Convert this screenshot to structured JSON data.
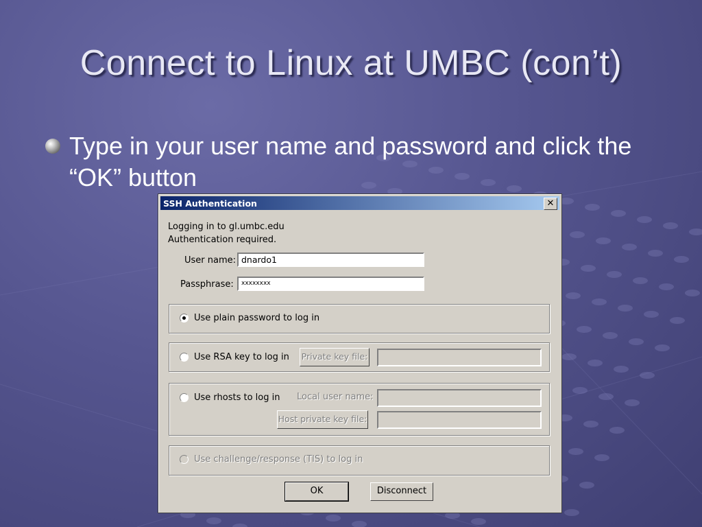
{
  "slide": {
    "title": "Connect to Linux at UMBC (con’t)",
    "bullet": "Type in your user name and password and click the “OK” button"
  },
  "dialog": {
    "title": "SSH Authentication",
    "close_glyph": "✕",
    "info_line1": "Logging in to gl.umbc.edu",
    "info_line2": "Authentication required.",
    "username_label": "User name:",
    "username_value": "dnardo1",
    "passphrase_label": "Passphrase:",
    "passphrase_value": "xxxxxxxx",
    "option_password": "Use plain password to log in",
    "option_rsa": "Use RSA key to log in",
    "private_key_button": "Private key file:",
    "option_rhosts": "Use rhosts to log in",
    "local_user_label": "Local user name:",
    "host_key_button": "Host private key file:",
    "option_tis": "Use challenge/response (TIS) to log in",
    "ok_label": "OK",
    "disconnect_label": "Disconnect",
    "selected_option": "password"
  },
  "colors": {
    "titlebar_start": "#0a246a",
    "titlebar_end": "#a6caf0",
    "dialog_face": "#d4d0c8",
    "slide_bg": "#55558f"
  }
}
